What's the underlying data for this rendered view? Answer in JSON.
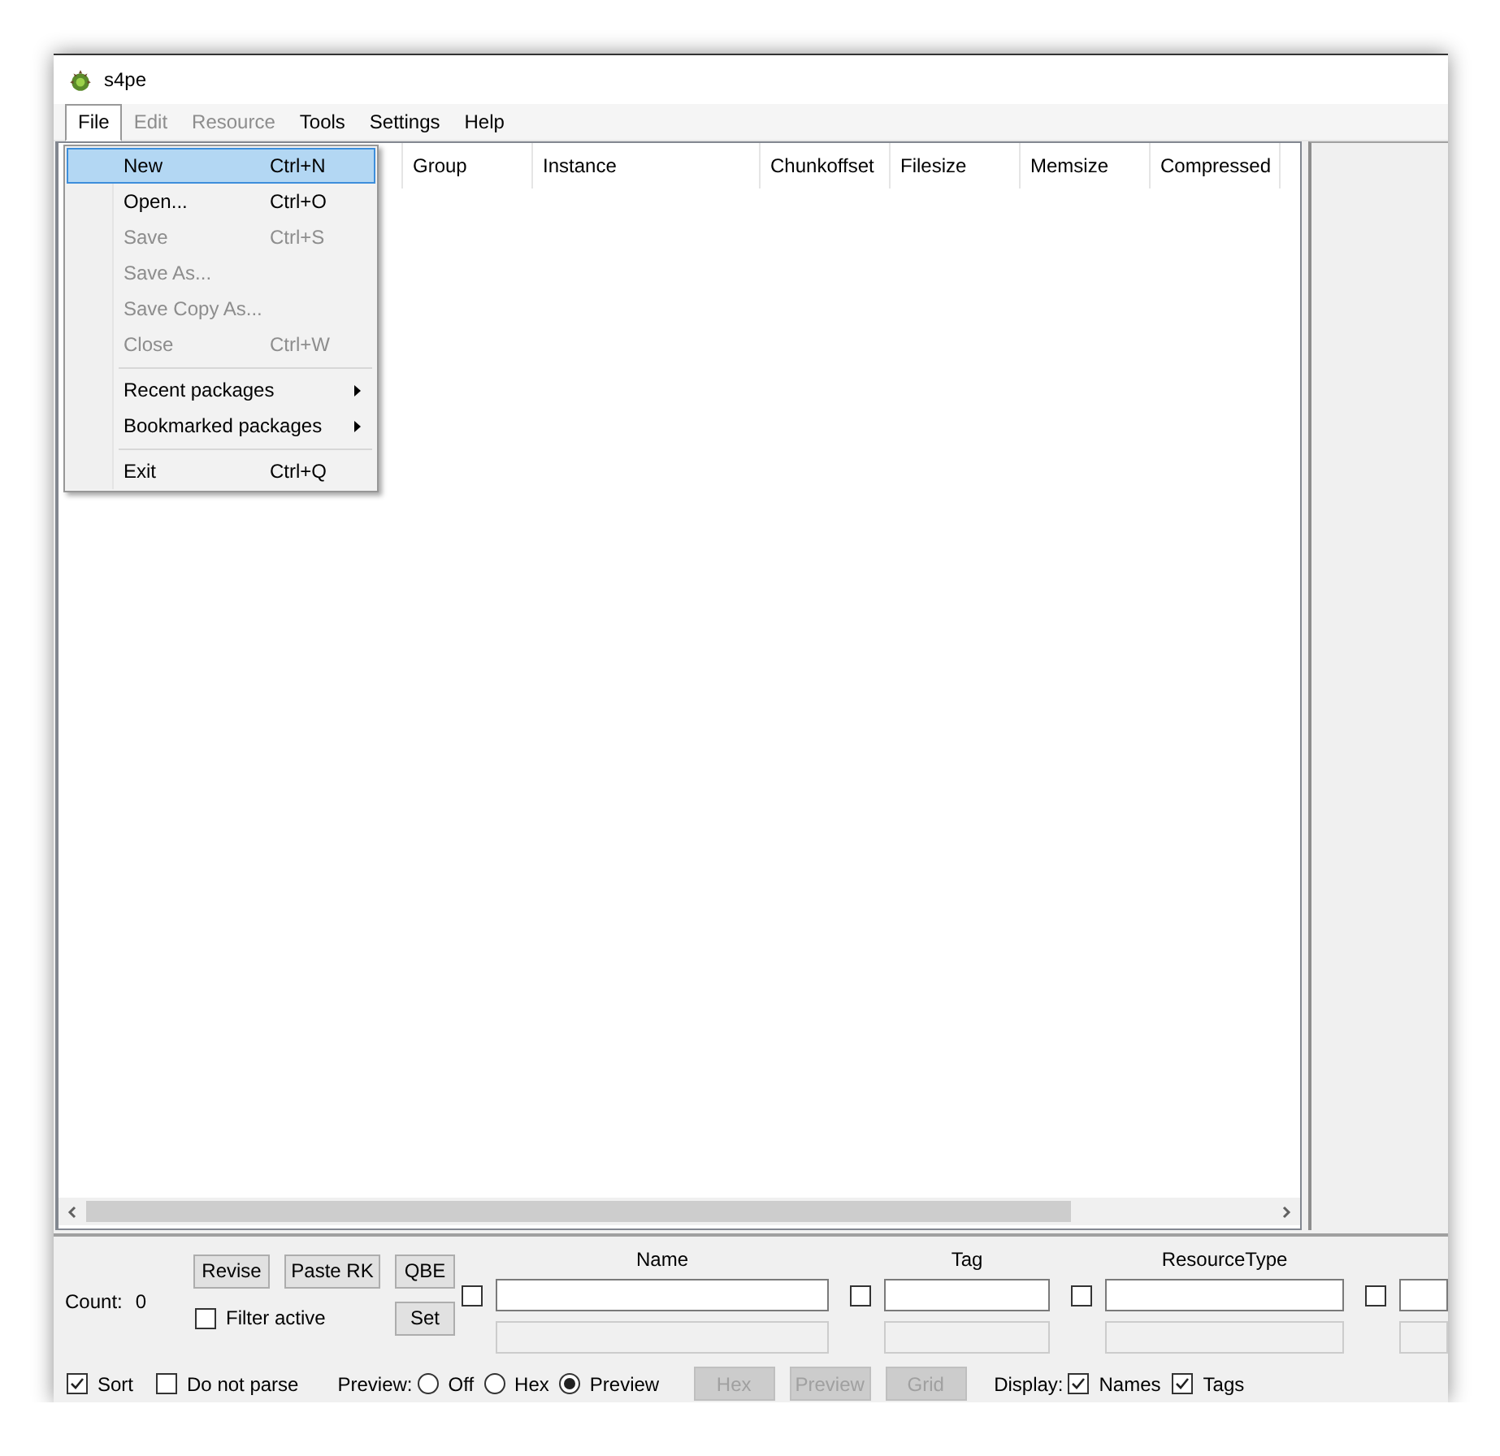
{
  "window": {
    "title": "s4pe"
  },
  "menu_bar": [
    {
      "label": "File",
      "selected": true,
      "disabled": false
    },
    {
      "label": "Edit",
      "selected": false,
      "disabled": true
    },
    {
      "label": "Resource",
      "selected": false,
      "disabled": true
    },
    {
      "label": "Tools",
      "selected": false,
      "disabled": false
    },
    {
      "label": "Settings",
      "selected": false,
      "disabled": false
    },
    {
      "label": "Help",
      "selected": false,
      "disabled": false
    }
  ],
  "file_menu": [
    {
      "kind": "item",
      "label": "New",
      "shortcut": "Ctrl+N",
      "selected": true,
      "disabled": false
    },
    {
      "kind": "item",
      "label": "Open...",
      "shortcut": "Ctrl+O",
      "selected": false,
      "disabled": false
    },
    {
      "kind": "item",
      "label": "Save",
      "shortcut": "Ctrl+S",
      "selected": false,
      "disabled": true
    },
    {
      "kind": "item",
      "label": "Save As...",
      "selected": false,
      "disabled": true
    },
    {
      "kind": "item",
      "label": "Save Copy As...",
      "selected": false,
      "disabled": true
    },
    {
      "kind": "item",
      "label": "Close",
      "shortcut": "Ctrl+W",
      "selected": false,
      "disabled": true
    },
    {
      "kind": "separator"
    },
    {
      "kind": "submenu",
      "label": "Recent packages",
      "selected": false,
      "disabled": false
    },
    {
      "kind": "submenu",
      "label": "Bookmarked packages",
      "selected": false,
      "disabled": false
    },
    {
      "kind": "separator"
    },
    {
      "kind": "item",
      "label": "Exit",
      "shortcut": "Ctrl+Q",
      "selected": false,
      "disabled": false
    }
  ],
  "table": {
    "columns": [
      "Group",
      "Instance",
      "Chunkoffset",
      "Filesize",
      "Memsize",
      "Compressed"
    ]
  },
  "count": {
    "label": "Count:",
    "value": "0"
  },
  "buttons": [
    {
      "label": "Revise",
      "disabled": false
    },
    {
      "label": "Paste RK",
      "disabled": false
    },
    {
      "label": "QBE",
      "disabled": false
    },
    {
      "label": "Set",
      "disabled": false
    }
  ],
  "filter_active": {
    "label": "Filter active",
    "checked": false
  },
  "filters": [
    {
      "label": "Name",
      "checked": false
    },
    {
      "label": "Tag",
      "checked": false
    },
    {
      "label": "ResourceType",
      "checked": false
    },
    {
      "checked": false
    }
  ],
  "options": [
    {
      "label": "Sort",
      "checked": true
    },
    {
      "label": "Do not parse",
      "checked": false
    }
  ],
  "preview": {
    "label": "Preview:",
    "options": [
      {
        "label": "Off",
        "selected": false
      },
      {
        "label": "Hex",
        "selected": false
      },
      {
        "label": "Preview",
        "selected": true
      }
    ]
  },
  "preview_buttons": [
    {
      "label": "Hex",
      "disabled": true
    },
    {
      "label": "Preview",
      "disabled": true
    },
    {
      "label": "Grid",
      "disabled": true
    }
  ],
  "display": {
    "label": "Display:",
    "options": [
      {
        "label": "Names",
        "checked": true
      },
      {
        "label": "Tags",
        "checked": true
      }
    ]
  }
}
